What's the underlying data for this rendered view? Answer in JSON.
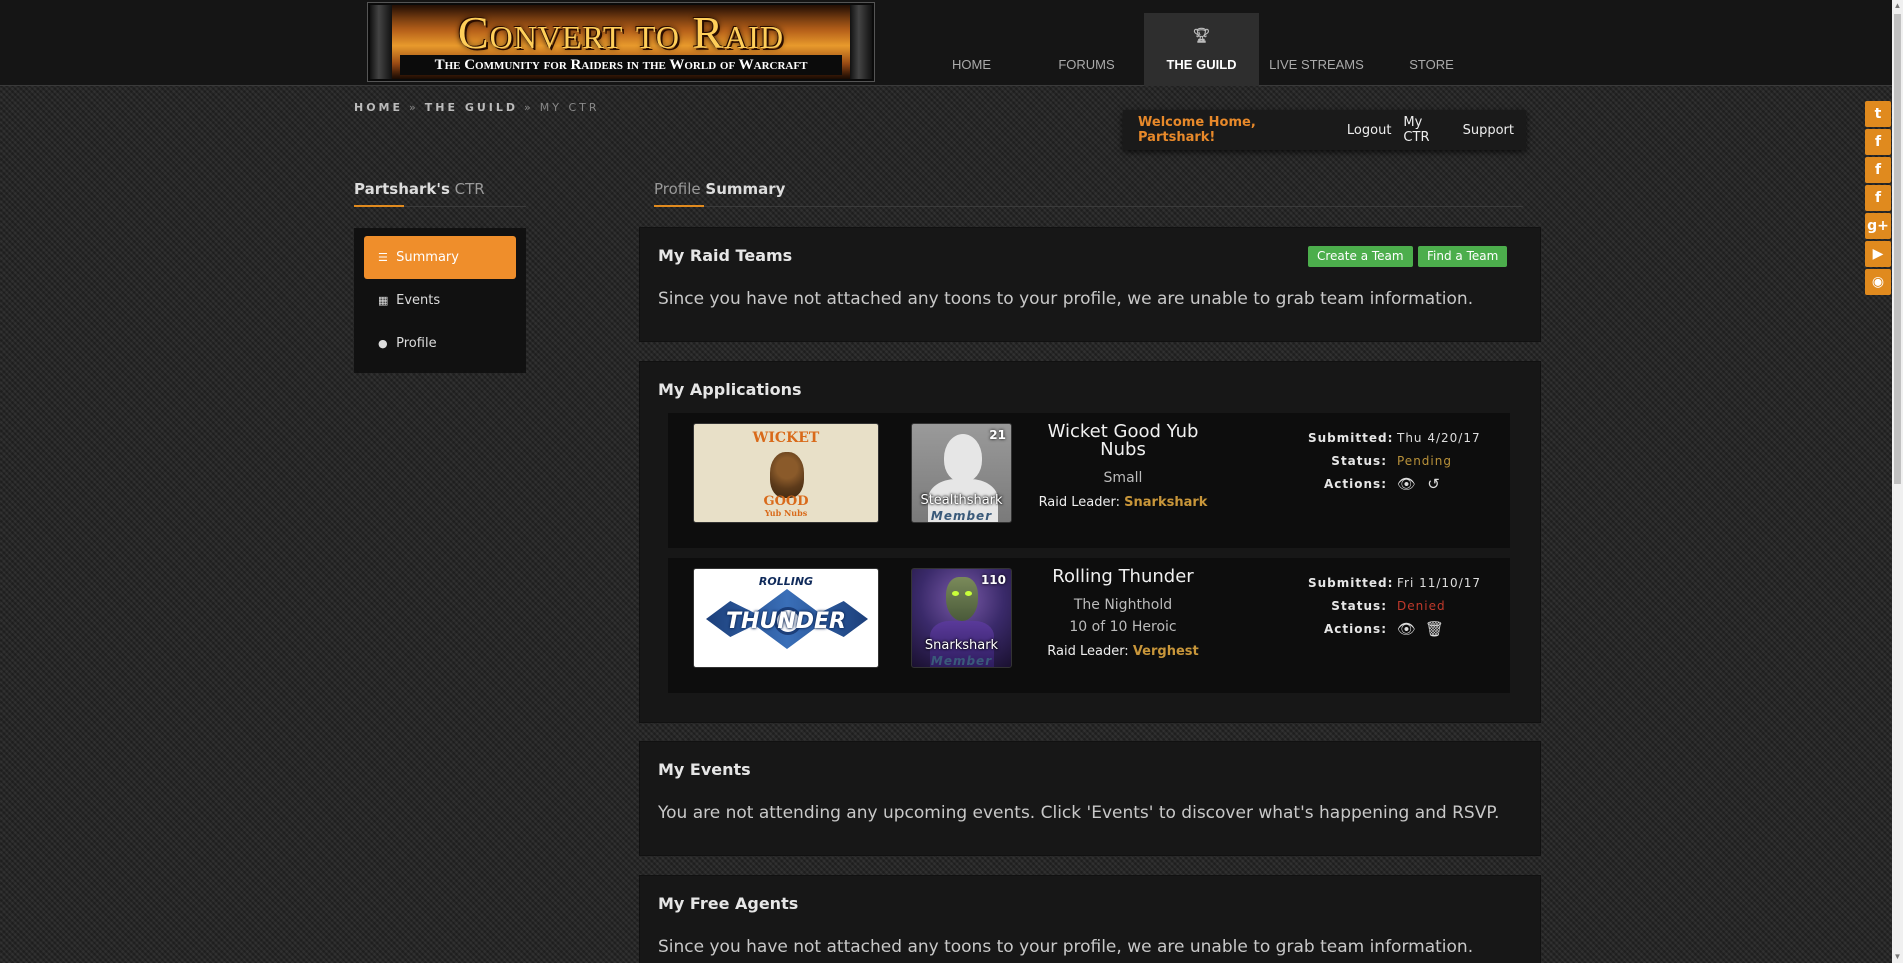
{
  "header": {
    "logo_title": "Convert to Raid",
    "logo_subtitle": "The Community for Raiders in the World of Warcraft",
    "nav": [
      {
        "label": "HOME"
      },
      {
        "label": "FORUMS"
      },
      {
        "label": "THE GUILD",
        "active": true
      },
      {
        "label": "LIVE STREAMS"
      },
      {
        "label": "STORE"
      }
    ]
  },
  "breadcrumb": [
    "HOME",
    "THE GUILD",
    "MY CTR"
  ],
  "welcome": {
    "greeting": "Welcome Home, Partshark!",
    "links": [
      "Logout",
      "My CTR",
      "Support"
    ]
  },
  "sidebar": {
    "title_strong": "Partshark's",
    "title_rest": " CTR",
    "items": [
      {
        "label": "Summary",
        "icon": "list-icon",
        "active": true
      },
      {
        "label": "Events",
        "icon": "calendar-icon"
      },
      {
        "label": "Profile",
        "icon": "user-icon"
      }
    ]
  },
  "main": {
    "title_light": "Profile ",
    "title_strong": "Summary",
    "raid_teams": {
      "title": "My Raid Teams",
      "create_label": "Create a Team",
      "find_label": "Find a Team",
      "text": "Since you have not attached any toons to your profile, we are unable to grab team information."
    },
    "applications": {
      "title": "My Applications",
      "items": [
        {
          "banner_top": "WICKET",
          "banner_mid": "GOOD",
          "banner_bot": "Yub Nubs",
          "level": "21",
          "character": "Stealthshark",
          "role": "Member",
          "team_name": "Wicket Good Yub Nubs",
          "team_lines": [
            "Small"
          ],
          "leader_label": "Raid Leader: ",
          "leader": "Snarkshark",
          "submitted_label": "Submitted:",
          "submitted": "Thu 4/20/17",
          "status_label": "Status:",
          "status": "Pending",
          "actions_label": "Actions:",
          "actions": [
            "eye-icon",
            "undo-icon"
          ]
        },
        {
          "banner_top": "ROLLING",
          "banner_mid": "THUNDER",
          "level": "110",
          "character": "Snarkshark",
          "role": "Member",
          "team_name": "Rolling Thunder",
          "team_lines": [
            "The Nighthold",
            "10 of 10 Heroic"
          ],
          "leader_label": "Raid Leader: ",
          "leader": "Verghest",
          "submitted_label": "Submitted:",
          "submitted": "Fri 11/10/17",
          "status_label": "Status:",
          "status": "Denied",
          "actions_label": "Actions:",
          "actions": [
            "eye-icon",
            "trash-icon"
          ]
        }
      ]
    },
    "events": {
      "title": "My Events",
      "text": "You are not attending any upcoming events. Click 'Events' to discover what's happening and RSVP."
    },
    "free_agents": {
      "title": "My Free Agents",
      "text": "Since you have not attached any toons to your profile, we are unable to grab team information."
    }
  },
  "social": [
    {
      "name": "twitter-icon",
      "glyph": "t"
    },
    {
      "name": "facebook-icon",
      "glyph": "f"
    },
    {
      "name": "facebook-page-icon",
      "glyph": "f"
    },
    {
      "name": "facebook-group-icon",
      "glyph": "f"
    },
    {
      "name": "google-plus-icon",
      "glyph": "g+"
    },
    {
      "name": "youtube-icon",
      "glyph": "▶"
    },
    {
      "name": "rss-icon",
      "glyph": "◉"
    }
  ],
  "colors": {
    "accent": "#ef8e2b",
    "green": "#4cae4c",
    "pending": "#b8913a",
    "denied": "#c0392b"
  }
}
